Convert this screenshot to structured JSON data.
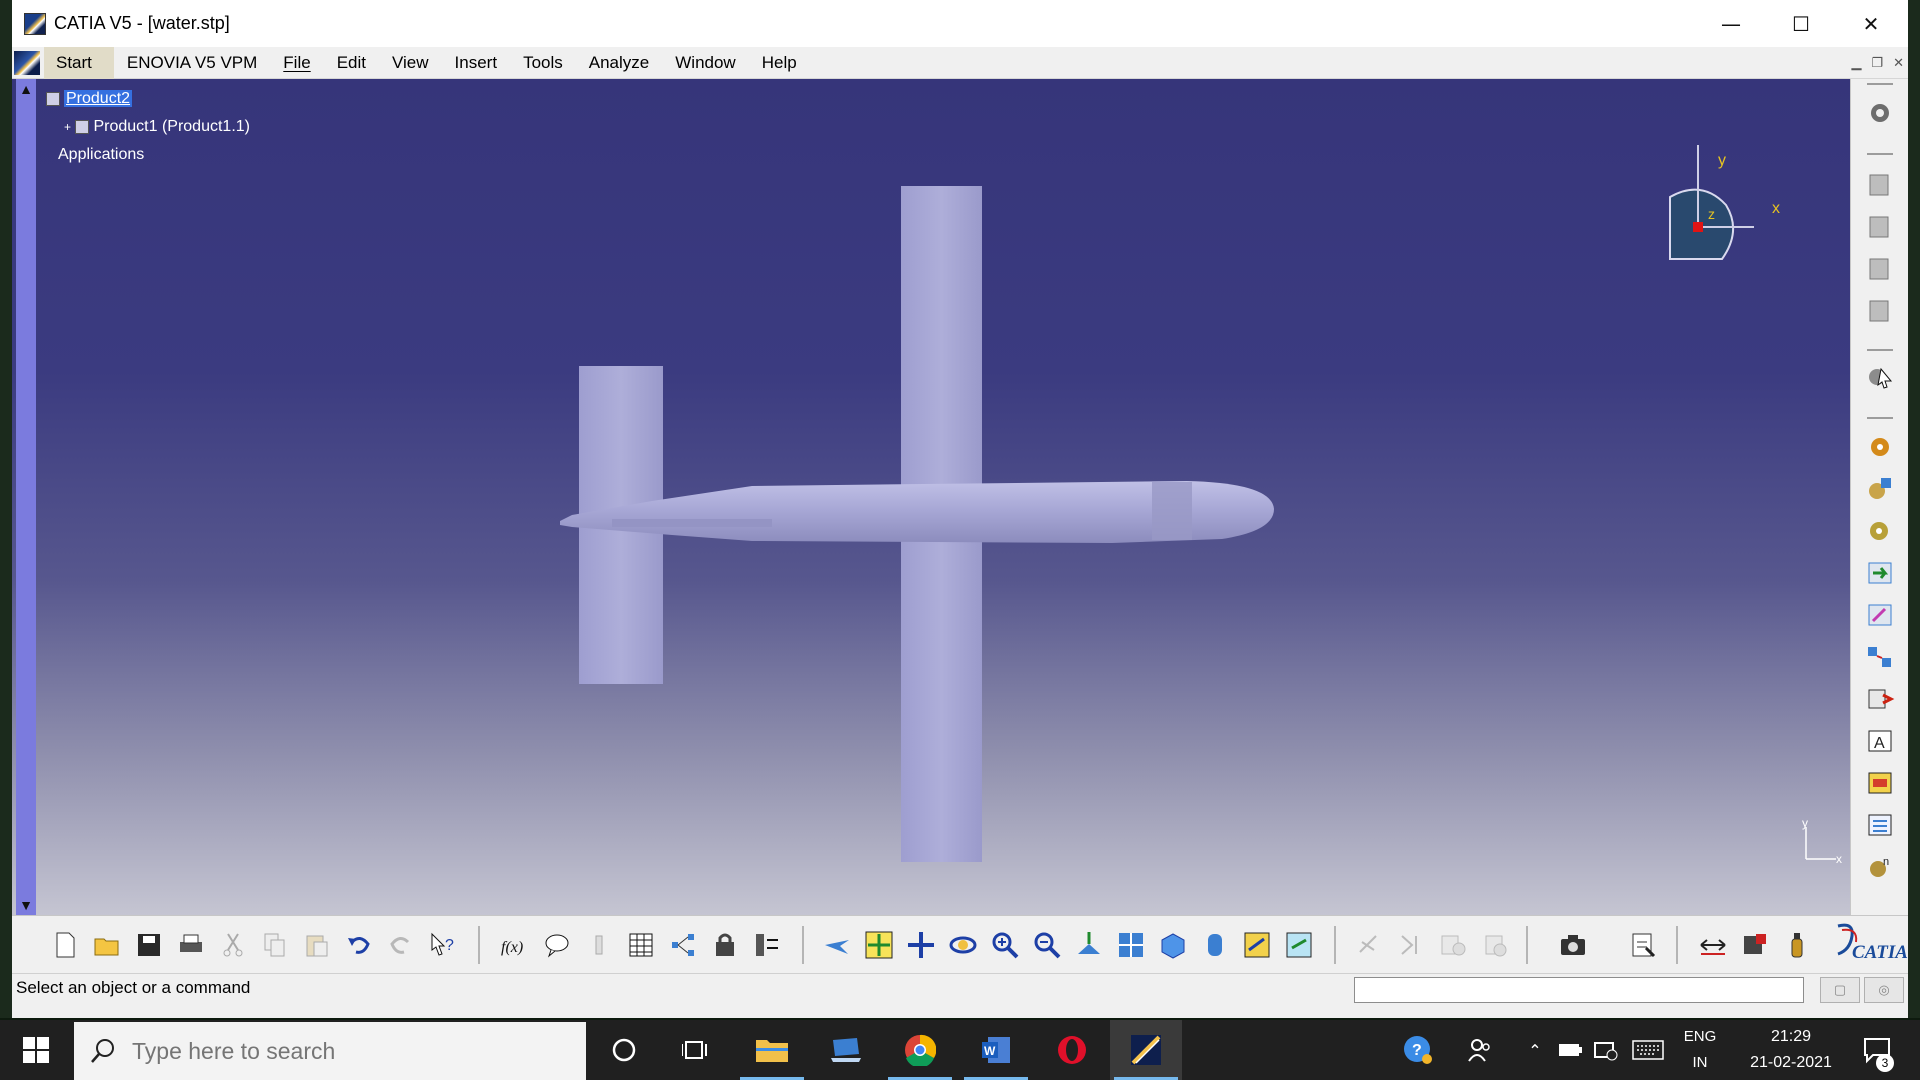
{
  "window": {
    "title": "CATIA V5 - [water.stp]",
    "controls": {
      "minimize": "—",
      "maximize": "☐",
      "close": "✕"
    }
  },
  "menu": {
    "items": [
      "Start",
      "ENOVIA V5 VPM",
      "File",
      "Edit",
      "View",
      "Insert",
      "Tools",
      "Analyze",
      "Window",
      "Help"
    ]
  },
  "tree": {
    "root": "Product2",
    "child": "Product1 (Product1.1)",
    "applications": "Applications"
  },
  "compass": {
    "x": "x",
    "y": "y",
    "z": "z"
  },
  "mini_axis": {
    "x": "x",
    "y": "y"
  },
  "colors": {
    "viewport_top": "#36357a",
    "viewport_bottom": "#c5c5d2",
    "model_fill": "#a9a9d4",
    "selection": "#3570e0",
    "tree_scroll": "#7b7bde",
    "taskbar": "#202020"
  },
  "right_toolbar": {
    "icons": [
      "sketcher-gear-icon",
      "product-structure-icon-1",
      "product-structure-icon-2",
      "product-structure-icon-3",
      "product-structure-icon-4",
      "select-arrow-icon",
      "constraint-gear-icon",
      "insert-component-icon",
      "manipulation-icon",
      "move-icon",
      "snap-icon",
      "explode-icon",
      "clash-icon",
      "sectioning-icon",
      "annotation-icon",
      "scenes-icon",
      "bill-of-material-icon",
      "catalog-icon"
    ]
  },
  "bottom_toolbar": {
    "icons": [
      "new-icon",
      "open-icon",
      "save-icon",
      "print-icon",
      "cut-icon",
      "copy-icon",
      "paste-icon",
      "undo-icon",
      "redo-icon",
      "whats-this-icon",
      "formula-icon",
      "knowledge-icon",
      "lamp-icon",
      "table-icon",
      "graph-icon",
      "lock-icon",
      "parameter-icon",
      "fly-icon",
      "fit-all-icon",
      "pan-icon",
      "rotate-icon",
      "zoom-in-icon",
      "zoom-out-icon",
      "normal-view-icon",
      "multi-view-icon",
      "iso-view-icon",
      "shading-icon",
      "hide-show-icon",
      "swap-icon",
      "stop-icon",
      "next-icon",
      "catalog-browser-icon",
      "component-icon",
      "capture-icon",
      "update-icon",
      "measure-icon",
      "inertia-icon",
      "bottle-icon"
    ],
    "logo": "CATIA"
  },
  "status": {
    "prompt": "Select an object or a command",
    "command_value": ""
  },
  "taskbar": {
    "search_placeholder": "Type here to search",
    "apps": [
      "cortana-icon",
      "task-view-icon",
      "file-explorer-icon",
      "laptop-app-icon",
      "chrome-icon",
      "word-icon",
      "opera-icon",
      "catia-taskbar-icon"
    ],
    "language_top": "ENG",
    "language_bottom": "IN",
    "time": "21:29",
    "date": "21-02-2021",
    "notifications": "3"
  }
}
